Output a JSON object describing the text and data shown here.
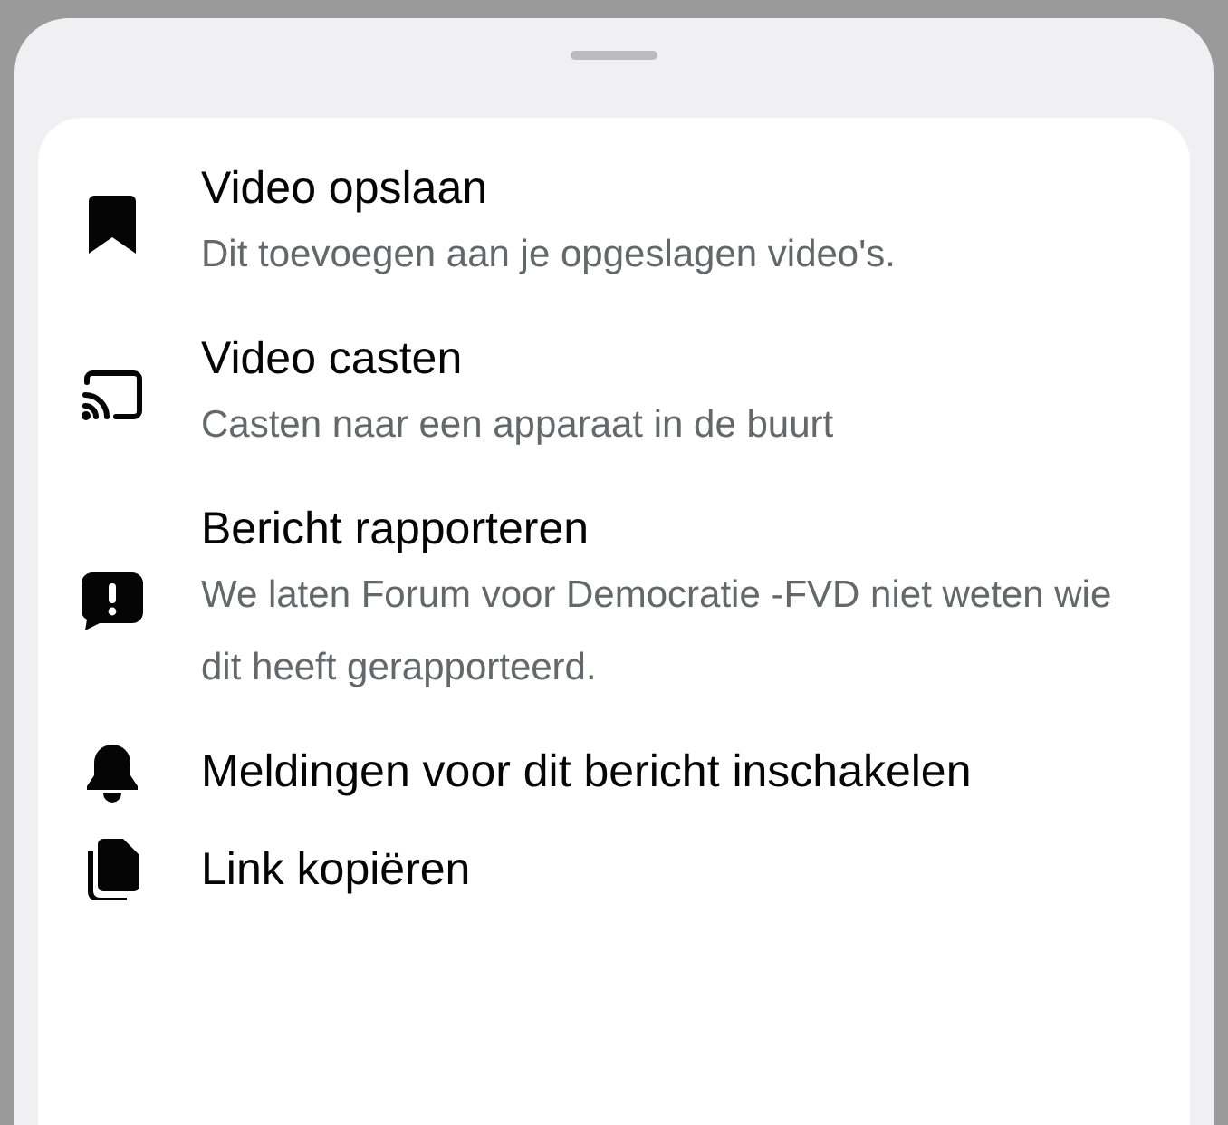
{
  "menu": {
    "items": [
      {
        "kind": "bookmark",
        "title": "Video opslaan",
        "subtitle": "Dit toevoegen aan je opgeslagen video's."
      },
      {
        "kind": "cast",
        "title": "Video casten",
        "subtitle": "Casten naar een apparaat in de buurt"
      },
      {
        "kind": "report",
        "title": "Bericht rapporteren",
        "subtitle": "We laten Forum voor Democratie -FVD niet weten wie dit heeft gerapporteerd."
      },
      {
        "kind": "bell",
        "title": "Meldingen voor dit bericht inschakelen"
      },
      {
        "kind": "copy",
        "title": "Link kopiëren"
      }
    ]
  }
}
